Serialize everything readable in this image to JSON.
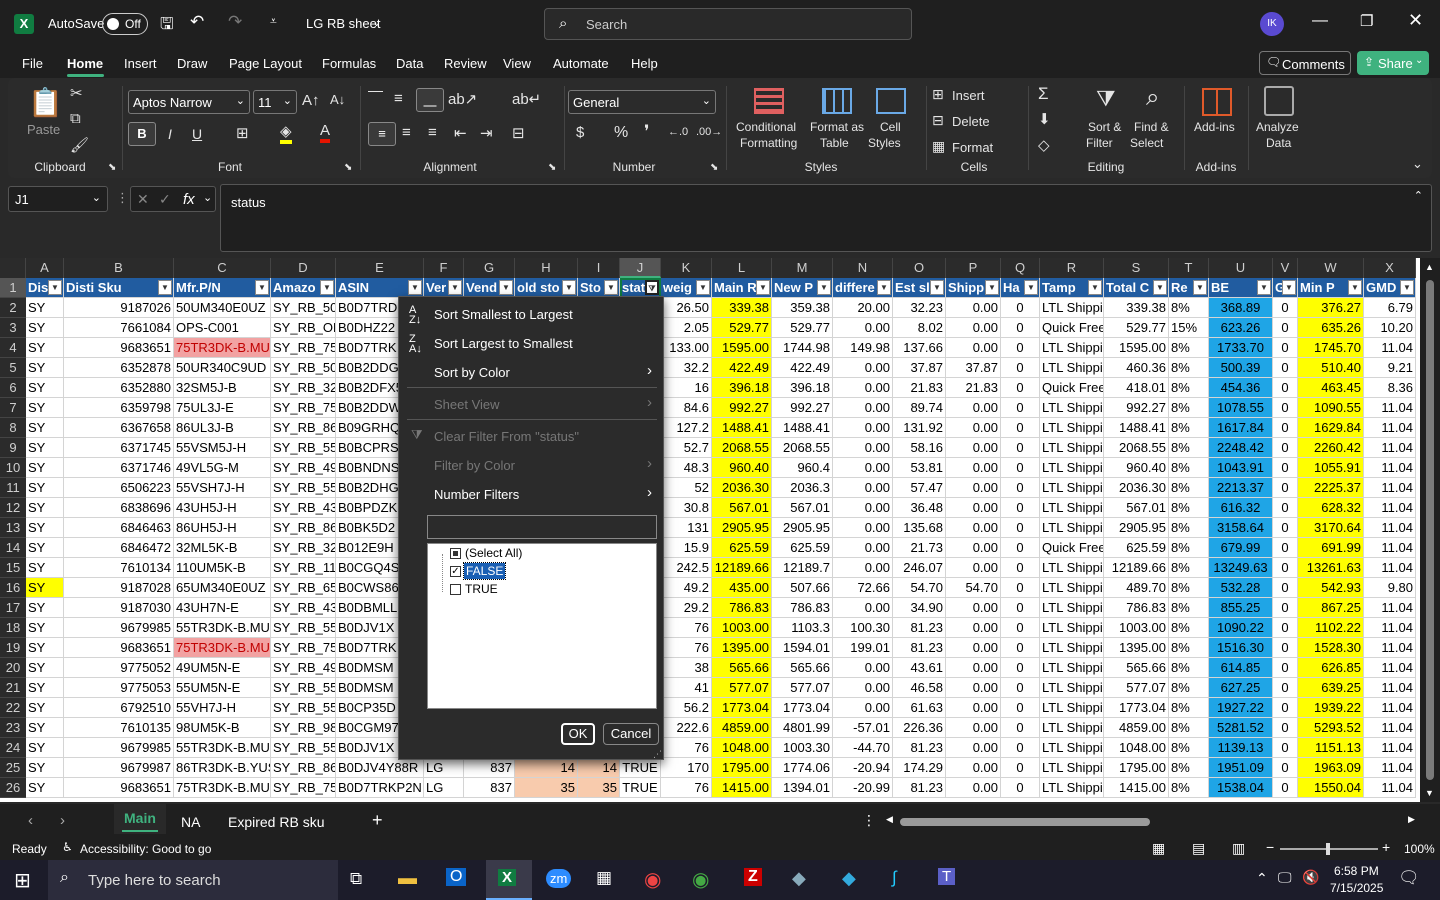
{
  "title": {
    "autosave": "AutoSave",
    "autosave_state": "Off",
    "filename": "LG RB sheet",
    "search": "Search",
    "avatar": "IK"
  },
  "menu": [
    "File",
    "Home",
    "Insert",
    "Draw",
    "Page Layout",
    "Formulas",
    "Data",
    "Review",
    "View",
    "Automate",
    "Help"
  ],
  "comments": "Comments",
  "share": "Share",
  "ribbon": {
    "paste": "Paste",
    "clipboard": "Clipboard",
    "font_name": "Aptos Narrow",
    "font_size": "11",
    "font": "Font",
    "alignment": "Alignment",
    "number_format": "General",
    "number": "Number",
    "cond1": "Conditional",
    "cond2": "Formatting",
    "fmt1": "Format as",
    "fmt2": "Table",
    "cs1": "Cell",
    "cs2": "Styles",
    "styles": "Styles",
    "insert": "Insert",
    "delete": "Delete",
    "format": "Format",
    "cells": "Cells",
    "sort1": "Sort &",
    "sort2": "Filter",
    "find1": "Find &",
    "find2": "Select",
    "editing": "Editing",
    "addins": "Add-ins",
    "addins_grp": "Add-ins",
    "analyze1": "Analyze",
    "analyze2": "Data"
  },
  "formula": {
    "namebox": "J1",
    "fx": "fx",
    "value": "status"
  },
  "columns": [
    "A",
    "B",
    "C",
    "D",
    "E",
    "F",
    "G",
    "H",
    "I",
    "J",
    "K",
    "L",
    "M",
    "N",
    "O",
    "P",
    "Q",
    "R",
    "S",
    "T",
    "U",
    "V",
    "W",
    "X"
  ],
  "headers": [
    "Dis",
    "Disti Sku",
    "Mfr.P/N",
    "Amazo",
    "ASIN",
    "Ver",
    "Vend",
    "old sto",
    "Sto",
    "stat",
    "weig",
    "Main R",
    "New P",
    "differe",
    "Est sl",
    "Shipp",
    "Ha",
    "Tamp",
    "Total C",
    "Re",
    "BE",
    "G",
    "Min P",
    "GMD"
  ],
  "rows": [
    [
      "SY",
      "9187026",
      "50UM340E0UZ",
      "SY_RB_50U",
      "B0D7TRD",
      "",
      "",
      "",
      "",
      "",
      "26.50",
      "339.38",
      "359.38",
      "20.00",
      "32.23",
      "0.00",
      "0",
      "LTL Shippi",
      "339.38",
      "8%",
      "368.89",
      "0",
      "376.27",
      "6.79"
    ],
    [
      "SY",
      "7661084",
      "OPS-C001",
      "SY_RB_OP",
      "B0DHZ22",
      "",
      "",
      "",
      "",
      "",
      "2.05",
      "529.77",
      "529.77",
      "0.00",
      "8.02",
      "0.00",
      "0",
      "Quick Free",
      "529.77",
      "15%",
      "623.26",
      "0",
      "635.26",
      "10.20"
    ],
    [
      "SY",
      "9683651",
      "75TR3DK-B.MUS",
      "SY_RB_75T",
      "B0D7TRK",
      "",
      "",
      "",
      "",
      "",
      "133.00",
      "1595.00",
      "1744.98",
      "149.98",
      "137.66",
      "0.00",
      "0",
      "LTL Shippi",
      "1595.00",
      "8%",
      "1733.70",
      "0",
      "1745.70",
      "11.04"
    ],
    [
      "SY",
      "6352878",
      "50UR340C9UD",
      "SY_RB_50U",
      "B0B2DDG",
      "",
      "",
      "",
      "",
      "",
      "32.2",
      "422.49",
      "422.49",
      "0.00",
      "37.87",
      "37.87",
      "0",
      "LTL Shippi",
      "460.36",
      "8%",
      "500.39",
      "0",
      "510.40",
      "9.21"
    ],
    [
      "SY",
      "6352880",
      "32SM5J-B",
      "SY_RB_32S",
      "B0B2DFX5",
      "",
      "",
      "",
      "",
      "",
      "16",
      "396.18",
      "396.18",
      "0.00",
      "21.83",
      "21.83",
      "0",
      "Quick Free",
      "418.01",
      "8%",
      "454.36",
      "0",
      "463.45",
      "8.36"
    ],
    [
      "SY",
      "6359798",
      "75UL3J-E",
      "SY_RB_75U",
      "B0B2DDW",
      "",
      "",
      "",
      "",
      "",
      "84.6",
      "992.27",
      "992.27",
      "0.00",
      "89.74",
      "0.00",
      "0",
      "LTL Shippi",
      "992.27",
      "8%",
      "1078.55",
      "0",
      "1090.55",
      "11.04"
    ],
    [
      "SY",
      "6367658",
      "86UL3J-B",
      "SY_RB_86U",
      "B09GRHQ",
      "",
      "",
      "",
      "",
      "",
      "127.2",
      "1488.41",
      "1488.41",
      "0.00",
      "131.92",
      "0.00",
      "0",
      "LTL Shippi",
      "1488.41",
      "8%",
      "1617.84",
      "0",
      "1629.84",
      "11.04"
    ],
    [
      "SY",
      "6371745",
      "55VSM5J-H",
      "SY_RB_55V",
      "B0BCPRS",
      "",
      "",
      "",
      "",
      "",
      "52.7",
      "2068.55",
      "2068.55",
      "0.00",
      "58.16",
      "0.00",
      "0",
      "LTL Shippi",
      "2068.55",
      "8%",
      "2248.42",
      "0",
      "2260.42",
      "11.04"
    ],
    [
      "SY",
      "6371746",
      "49VL5G-M",
      "SY_RB_49V",
      "B0BNDNS",
      "",
      "",
      "",
      "",
      "",
      "48.3",
      "960.40",
      "960.4",
      "0.00",
      "53.81",
      "0.00",
      "0",
      "LTL Shippi",
      "960.40",
      "8%",
      "1043.91",
      "0",
      "1055.91",
      "11.04"
    ],
    [
      "SY",
      "6506223",
      "55VSH7J-H",
      "SY_RB_55V",
      "B0B2DHG",
      "",
      "",
      "",
      "",
      "",
      "52",
      "2036.30",
      "2036.3",
      "0.00",
      "57.47",
      "0.00",
      "0",
      "LTL Shippi",
      "2036.30",
      "8%",
      "2213.37",
      "0",
      "2225.37",
      "11.04"
    ],
    [
      "SY",
      "6838696",
      "43UH5J-H",
      "SY_RB_43U",
      "B0BPDZK",
      "",
      "",
      "",
      "",
      "",
      "30.8",
      "567.01",
      "567.01",
      "0.00",
      "36.48",
      "0.00",
      "0",
      "LTL Shippi",
      "567.01",
      "8%",
      "616.32",
      "0",
      "628.32",
      "11.04"
    ],
    [
      "SY",
      "6846463",
      "86UH5J-H",
      "SY_RB_86U",
      "B0BK5D2",
      "",
      "",
      "",
      "",
      "",
      "131",
      "2905.95",
      "2905.95",
      "0.00",
      "135.68",
      "0.00",
      "0",
      "LTL Shippi",
      "2905.95",
      "8%",
      "3158.64",
      "0",
      "3170.64",
      "11.04"
    ],
    [
      "SY",
      "6846472",
      "32ML5K-B",
      "SY_RB_32M",
      "B012E9H",
      "",
      "",
      "",
      "",
      "",
      "15.9",
      "625.59",
      "625.59",
      "0.00",
      "21.73",
      "0.00",
      "0",
      "Quick Free",
      "625.59",
      "8%",
      "679.99",
      "0",
      "691.99",
      "11.04"
    ],
    [
      "SY",
      "7610134",
      "110UM5K-B",
      "SY_RB_110",
      "B0CGQ4S",
      "",
      "",
      "",
      "",
      "",
      "242.5",
      "12189.66",
      "12189.7",
      "0.00",
      "246.07",
      "0.00",
      "0",
      "LTL Shippi",
      "12189.66",
      "8%",
      "13249.63",
      "0",
      "13261.63",
      "11.04"
    ],
    [
      "SY",
      "9187028",
      "65UM340E0UZ",
      "SY_RB_65U",
      "B0CWS86",
      "",
      "",
      "",
      "",
      "",
      "49.2",
      "435.00",
      "507.66",
      "72.66",
      "54.70",
      "54.70",
      "0",
      "LTL Shippi",
      "489.70",
      "8%",
      "532.28",
      "0",
      "542.93",
      "9.80"
    ],
    [
      "SY",
      "9187030",
      "43UH7N-E",
      "SY_RB_43U",
      "B0DBMLL",
      "",
      "",
      "",
      "",
      "",
      "29.2",
      "786.83",
      "786.83",
      "0.00",
      "34.90",
      "0.00",
      "0",
      "LTL Shippi",
      "786.83",
      "8%",
      "855.25",
      "0",
      "867.25",
      "11.04"
    ],
    [
      "SY",
      "9679985",
      "55TR3DK-B.MUS",
      "SY_RB_55T",
      "B0DJV1X",
      "",
      "",
      "",
      "",
      "",
      "76",
      "1003.00",
      "1103.3",
      "100.30",
      "81.23",
      "0.00",
      "0",
      "LTL Shippi",
      "1003.00",
      "8%",
      "1090.22",
      "0",
      "1102.22",
      "11.04"
    ],
    [
      "SY",
      "9683651",
      "75TR3DK-B.MUS",
      "SY_RB_75T",
      "B0D7TRK",
      "",
      "",
      "",
      "",
      "",
      "76",
      "1395.00",
      "1594.01",
      "199.01",
      "81.23",
      "0.00",
      "0",
      "LTL Shippi",
      "1395.00",
      "8%",
      "1516.30",
      "0",
      "1528.30",
      "11.04"
    ],
    [
      "SY",
      "9775052",
      "49UM5N-E",
      "SY_RB_49U",
      "B0DMSM",
      "",
      "",
      "",
      "",
      "",
      "38",
      "565.66",
      "565.66",
      "0.00",
      "43.61",
      "0.00",
      "0",
      "LTL Shippi",
      "565.66",
      "8%",
      "614.85",
      "0",
      "626.85",
      "11.04"
    ],
    [
      "SY",
      "9775053",
      "55UM5N-E",
      "SY_RB_55U",
      "B0DMSM",
      "",
      "",
      "",
      "",
      "",
      "41",
      "577.07",
      "577.07",
      "0.00",
      "46.58",
      "0.00",
      "0",
      "LTL Shippi",
      "577.07",
      "8%",
      "627.25",
      "0",
      "639.25",
      "11.04"
    ],
    [
      "SY",
      "6792510",
      "55VH7J-H",
      "SY_RB_55V",
      "B0CP35D",
      "",
      "",
      "",
      "",
      "",
      "56.2",
      "1773.04",
      "1773.04",
      "0.00",
      "61.63",
      "0.00",
      "0",
      "LTL Shippi",
      "1773.04",
      "8%",
      "1927.22",
      "0",
      "1939.22",
      "11.04"
    ],
    [
      "SY",
      "7610135",
      "98UM5K-B",
      "SY_RB_98U",
      "B0CGM97",
      "",
      "",
      "",
      "",
      "",
      "222.6",
      "4859.00",
      "4801.99",
      "-57.01",
      "226.36",
      "0.00",
      "0",
      "LTL Shippi",
      "4859.00",
      "8%",
      "5281.52",
      "0",
      "5293.52",
      "11.04"
    ],
    [
      "SY",
      "9679985",
      "55TR3DK-B.MUS",
      "SY_RB_55T",
      "B0DJV1X",
      "",
      "",
      "",
      "",
      "",
      "76",
      "1048.00",
      "1003.30",
      "-44.70",
      "81.23",
      "0.00",
      "0",
      "LTL Shippi",
      "1048.00",
      "8%",
      "1139.13",
      "0",
      "1151.13",
      "11.04"
    ],
    [
      "SY",
      "9679987",
      "86TR3DK-B.YUS",
      "SY_RB_86T",
      "B0DJV4Y88R",
      "LG",
      "837",
      "14",
      "14",
      "TRUE",
      "170",
      "1795.00",
      "1774.06",
      "-20.94",
      "174.29",
      "0.00",
      "0",
      "LTL Shippi",
      "1795.00",
      "8%",
      "1951.09",
      "0",
      "1963.09",
      "11.04"
    ],
    [
      "SY",
      "9683651",
      "75TR3DK-B.MUS",
      "SY_RB_75T",
      "B0D7TRKP2N",
      "LG",
      "837",
      "35",
      "35",
      "TRUE",
      "76",
      "1415.00",
      "1394.01",
      "-20.99",
      "81.23",
      "0.00",
      "0",
      "LTL Shippi",
      "1415.00",
      "8%",
      "1538.04",
      "0",
      "1550.04",
      "11.04"
    ]
  ],
  "filter_menu": {
    "sort_asc": "Sort Smallest to Largest",
    "sort_desc": "Sort Largest to Smallest",
    "sort_color": "Sort by Color",
    "sheet_view": "Sheet View",
    "clear": "Clear Filter From \"status\"",
    "filter_color": "Filter by Color",
    "number_filters": "Number Filters",
    "select_all": "(Select All)",
    "opt_false": "FALSE",
    "opt_true": "TRUE",
    "ok": "OK",
    "cancel": "Cancel"
  },
  "sheets": [
    "Main",
    "NA",
    "Expired RB sku"
  ],
  "status": {
    "ready": "Ready",
    "accessibility": "Accessibility: Good to go",
    "zoom": "100%"
  },
  "taskbar": {
    "search": "Type here to search",
    "time": "6:58 PM",
    "date": "7/15/2025"
  }
}
